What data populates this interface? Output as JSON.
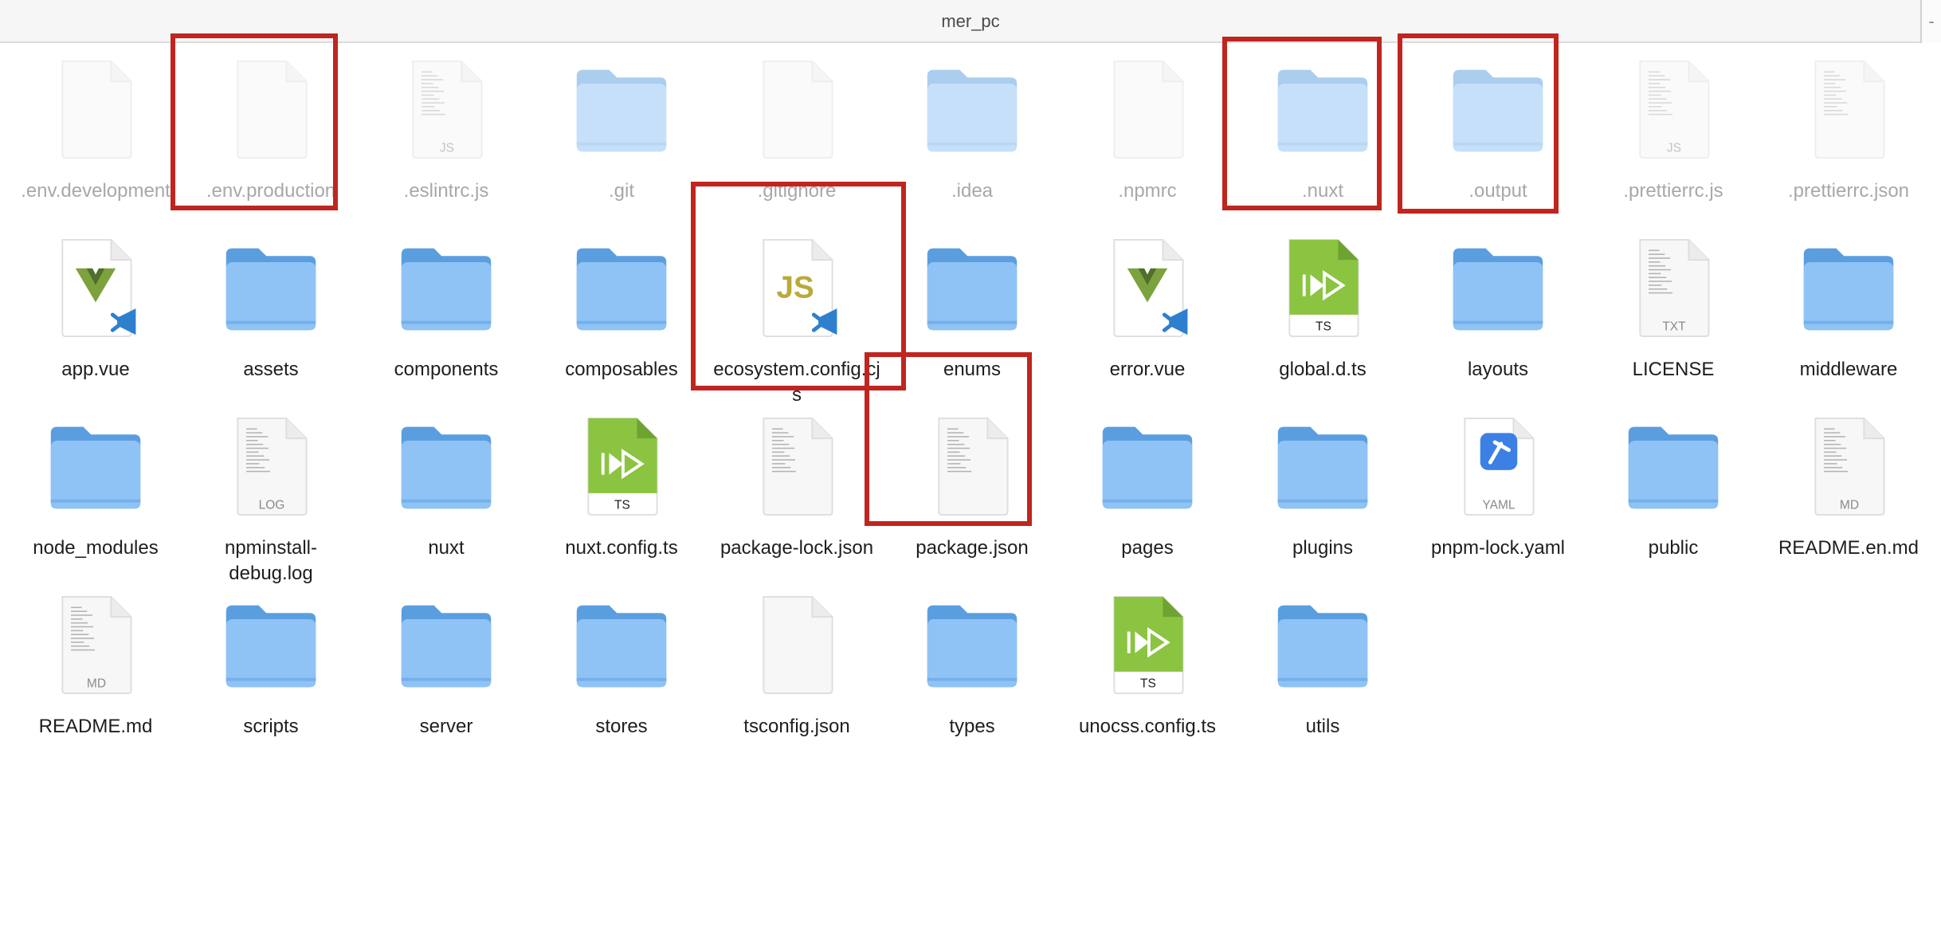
{
  "window": {
    "title": "mer_pc",
    "edge_glyph": "-"
  },
  "colors": {
    "folder_back": "#5a9ee0",
    "folder_front": "#8fc3f5",
    "highlight": "#c0251f",
    "ts_green": "#8bc441",
    "yaml_blue": "#3c80e5",
    "js_yellow": "#b9aa3a",
    "vue_green": "#7ba23c",
    "vscode_blue": "#2f7fcf"
  },
  "files": [
    {
      "name": ".env.development",
      "kind": "doc",
      "hidden": true
    },
    {
      "name": ".env.production",
      "kind": "doc",
      "hidden": true
    },
    {
      "name": ".eslintrc.js",
      "kind": "text",
      "tag": "JS",
      "hidden": true
    },
    {
      "name": ".git",
      "kind": "folder",
      "hidden": true
    },
    {
      "name": ".gitignore",
      "kind": "doc",
      "hidden": true
    },
    {
      "name": ".idea",
      "kind": "folder",
      "hidden": true
    },
    {
      "name": ".npmrc",
      "kind": "doc",
      "hidden": true
    },
    {
      "name": ".nuxt",
      "kind": "folder",
      "hidden": true
    },
    {
      "name": ".output",
      "kind": "folder",
      "hidden": true
    },
    {
      "name": ".prettierrc.js",
      "kind": "text",
      "tag": "JS",
      "hidden": true
    },
    {
      "name": ".prettierrc.json",
      "kind": "text",
      "hidden": true
    },
    {
      "name": "app.vue",
      "kind": "vue"
    },
    {
      "name": "assets",
      "kind": "folder"
    },
    {
      "name": "components",
      "kind": "folder"
    },
    {
      "name": "composables",
      "kind": "folder"
    },
    {
      "name": "ecosystem.config.cjs",
      "kind": "js",
      "glyph": "JS"
    },
    {
      "name": "enums",
      "kind": "folder"
    },
    {
      "name": "error.vue",
      "kind": "vue"
    },
    {
      "name": "global.d.ts",
      "kind": "ts",
      "tag": "TS"
    },
    {
      "name": "layouts",
      "kind": "folder"
    },
    {
      "name": "LICENSE",
      "kind": "text",
      "tag": "TXT"
    },
    {
      "name": "middleware",
      "kind": "folder"
    },
    {
      "name": "node_modules",
      "kind": "folder"
    },
    {
      "name": "npminstall-debug.log",
      "kind": "text",
      "tag": "LOG"
    },
    {
      "name": "nuxt",
      "kind": "folder"
    },
    {
      "name": "nuxt.config.ts",
      "kind": "ts",
      "tag": "TS"
    },
    {
      "name": "package-lock.json",
      "kind": "text"
    },
    {
      "name": "package.json",
      "kind": "text"
    },
    {
      "name": "pages",
      "kind": "folder"
    },
    {
      "name": "plugins",
      "kind": "folder"
    },
    {
      "name": "pnpm-lock.yaml",
      "kind": "yaml",
      "tag": "YAML"
    },
    {
      "name": "public",
      "kind": "folder"
    },
    {
      "name": "README.en.md",
      "kind": "text",
      "tag": "MD"
    },
    {
      "name": "README.md",
      "kind": "text",
      "tag": "MD"
    },
    {
      "name": "scripts",
      "kind": "folder"
    },
    {
      "name": "server",
      "kind": "folder"
    },
    {
      "name": "stores",
      "kind": "folder"
    },
    {
      "name": "tsconfig.json",
      "kind": "doc"
    },
    {
      "name": "types",
      "kind": "folder"
    },
    {
      "name": "unocss.config.ts",
      "kind": "ts",
      "tag": "TS"
    },
    {
      "name": "utils",
      "kind": "folder"
    }
  ],
  "annotations": [
    {
      "target": ".env.production"
    },
    {
      "target": ".nuxt"
    },
    {
      "target": ".output"
    },
    {
      "target": "ecosystem.config.cjs"
    },
    {
      "target": "package.json"
    }
  ]
}
